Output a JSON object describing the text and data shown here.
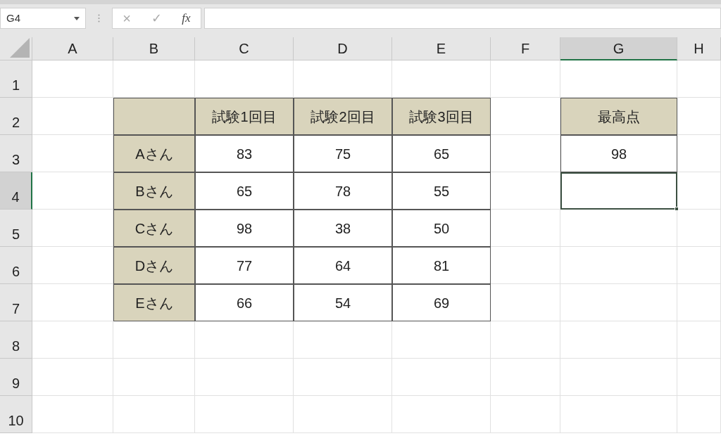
{
  "formula_bar": {
    "name_box": "G4",
    "cancel": "×",
    "enter": "✓",
    "function": "fx"
  },
  "columns": [
    {
      "label": "A",
      "selected": false
    },
    {
      "label": "B",
      "selected": false
    },
    {
      "label": "C",
      "selected": false
    },
    {
      "label": "D",
      "selected": false
    },
    {
      "label": "E",
      "selected": false
    },
    {
      "label": "F",
      "selected": false
    },
    {
      "label": "G",
      "selected": true
    },
    {
      "label": "H",
      "selected": false
    }
  ],
  "rows": [
    {
      "label": "1",
      "selected": false,
      "cells": [
        null,
        null,
        null,
        null,
        null,
        null,
        null,
        null
      ]
    },
    {
      "label": "2",
      "selected": false,
      "cells": [
        null,
        {
          "kind": "label",
          "selected": false
        },
        {
          "kind": "label",
          "text": "試験1回目",
          "selected": false
        },
        {
          "kind": "label",
          "text": "試験2回目",
          "selected": false
        },
        {
          "kind": "label",
          "text": "試験3回目",
          "selected": false
        },
        null,
        {
          "kind": "label",
          "text": "最高点",
          "selected": false
        },
        null
      ]
    },
    {
      "label": "3",
      "selected": false,
      "cells": [
        null,
        {
          "kind": "label",
          "text": "Aさん",
          "selected": false
        },
        {
          "kind": "value",
          "text": "83",
          "selected": false
        },
        {
          "kind": "value",
          "text": "75",
          "selected": false
        },
        {
          "kind": "value",
          "text": "65",
          "selected": false
        },
        null,
        {
          "kind": "value",
          "text": "98",
          "selected": false
        },
        null
      ]
    },
    {
      "label": "4",
      "selected": true,
      "cells": [
        null,
        {
          "kind": "label",
          "text": "Bさん",
          "selected": false
        },
        {
          "kind": "value",
          "text": "65",
          "selected": false
        },
        {
          "kind": "value",
          "text": "78",
          "selected": false
        },
        {
          "kind": "value",
          "text": "55",
          "selected": false
        },
        null,
        {
          "kind": "value",
          "selected": true
        },
        null
      ]
    },
    {
      "label": "5",
      "selected": false,
      "cells": [
        null,
        {
          "kind": "label",
          "text": "Cさん",
          "selected": false
        },
        {
          "kind": "value",
          "text": "98",
          "selected": false
        },
        {
          "kind": "value",
          "text": "38",
          "selected": false
        },
        {
          "kind": "value",
          "text": "50",
          "selected": false
        },
        null,
        null,
        null
      ]
    },
    {
      "label": "6",
      "selected": false,
      "cells": [
        null,
        {
          "kind": "label",
          "text": "Dさん",
          "selected": false
        },
        {
          "kind": "value",
          "text": "77",
          "selected": false
        },
        {
          "kind": "value",
          "text": "64",
          "selected": false
        },
        {
          "kind": "value",
          "text": "81",
          "selected": false
        },
        null,
        null,
        null
      ]
    },
    {
      "label": "7",
      "selected": false,
      "cells": [
        null,
        {
          "kind": "label",
          "text": "Eさん",
          "selected": false
        },
        {
          "kind": "value",
          "text": "66",
          "selected": false
        },
        {
          "kind": "value",
          "text": "54",
          "selected": false
        },
        {
          "kind": "value",
          "text": "69",
          "selected": false
        },
        null,
        null,
        null
      ]
    },
    {
      "label": "8",
      "selected": false,
      "cells": [
        null,
        null,
        null,
        null,
        null,
        null,
        null,
        null
      ]
    },
    {
      "label": "9",
      "selected": false,
      "cells": [
        null,
        null,
        null,
        null,
        null,
        null,
        null,
        null
      ]
    },
    {
      "label": "10",
      "selected": false,
      "cells": [
        null,
        null,
        null,
        null,
        null,
        null,
        null,
        null
      ]
    }
  ]
}
